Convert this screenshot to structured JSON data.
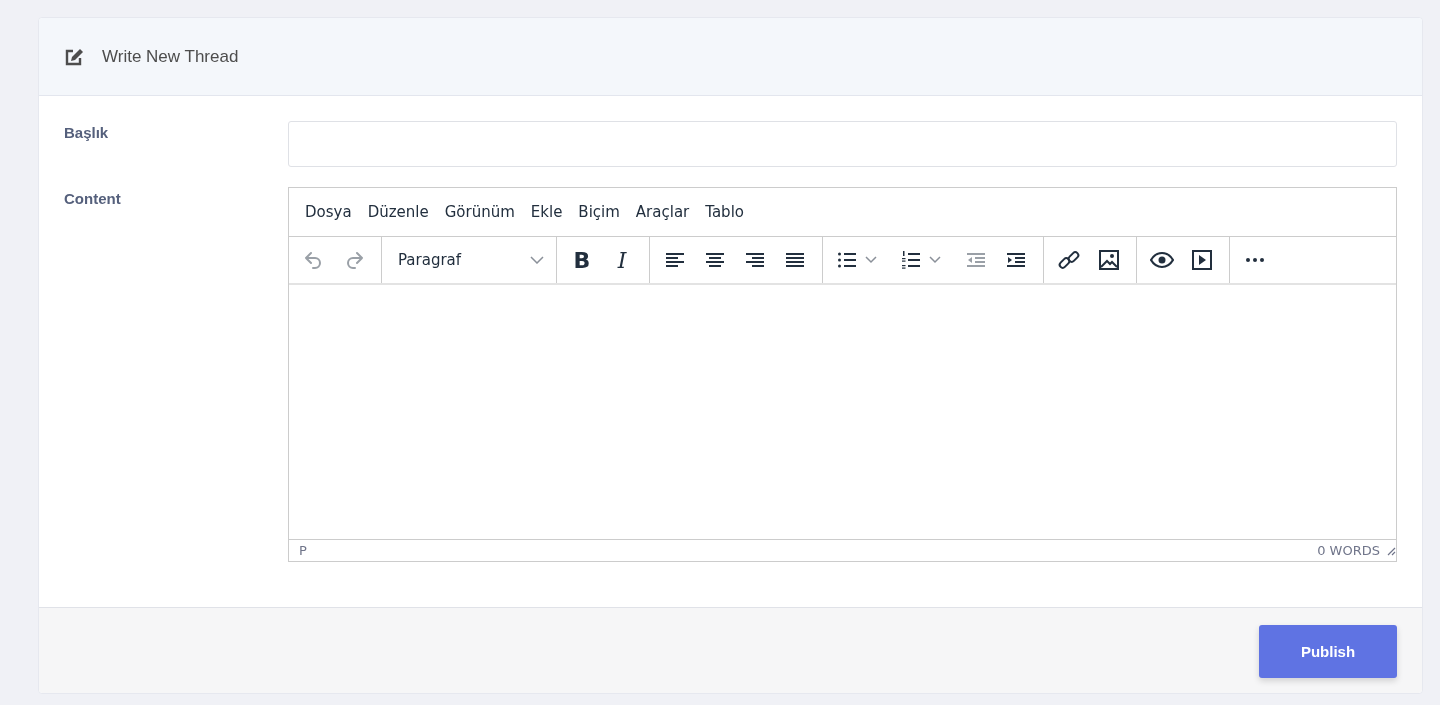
{
  "card": {
    "title": "Write New Thread"
  },
  "fields": [
    {
      "label": "Başlık",
      "kind": "text"
    },
    {
      "label": "Content",
      "kind": "editor"
    }
  ],
  "editor": {
    "menu": [
      "Dosya",
      "Düzenle",
      "Görünüm",
      "Ekle",
      "Biçim",
      "Araçlar",
      "Tablo"
    ],
    "toolbar": [
      [
        {
          "kind": "undo",
          "disabled": true
        },
        {
          "kind": "redo",
          "disabled": true
        }
      ],
      [
        {
          "kind": "select",
          "value": "Paragraf",
          "disabled": false
        }
      ],
      [
        {
          "kind": "bold",
          "glyph": "B",
          "disabled": false
        },
        {
          "kind": "italic",
          "glyph": "I",
          "disabled": false
        }
      ],
      [
        {
          "kind": "align-left",
          "disabled": false
        },
        {
          "kind": "align-center",
          "disabled": false
        },
        {
          "kind": "align-right",
          "disabled": false
        },
        {
          "kind": "align-justify",
          "disabled": false
        }
      ],
      [
        {
          "kind": "bullet-list",
          "split": true,
          "disabled": false
        },
        {
          "kind": "numbered-list",
          "split": true,
          "disabled": false
        },
        {
          "kind": "outdent",
          "disabled": true
        },
        {
          "kind": "indent",
          "disabled": false
        }
      ],
      [
        {
          "kind": "link",
          "disabled": false
        },
        {
          "kind": "image",
          "disabled": false
        }
      ],
      [
        {
          "kind": "preview",
          "disabled": false
        },
        {
          "kind": "media",
          "disabled": false
        }
      ],
      [
        {
          "kind": "more",
          "disabled": false
        }
      ]
    ],
    "path": "P",
    "word_count": "0 WORDS"
  },
  "actions": [
    {
      "label": "Publish"
    }
  ]
}
